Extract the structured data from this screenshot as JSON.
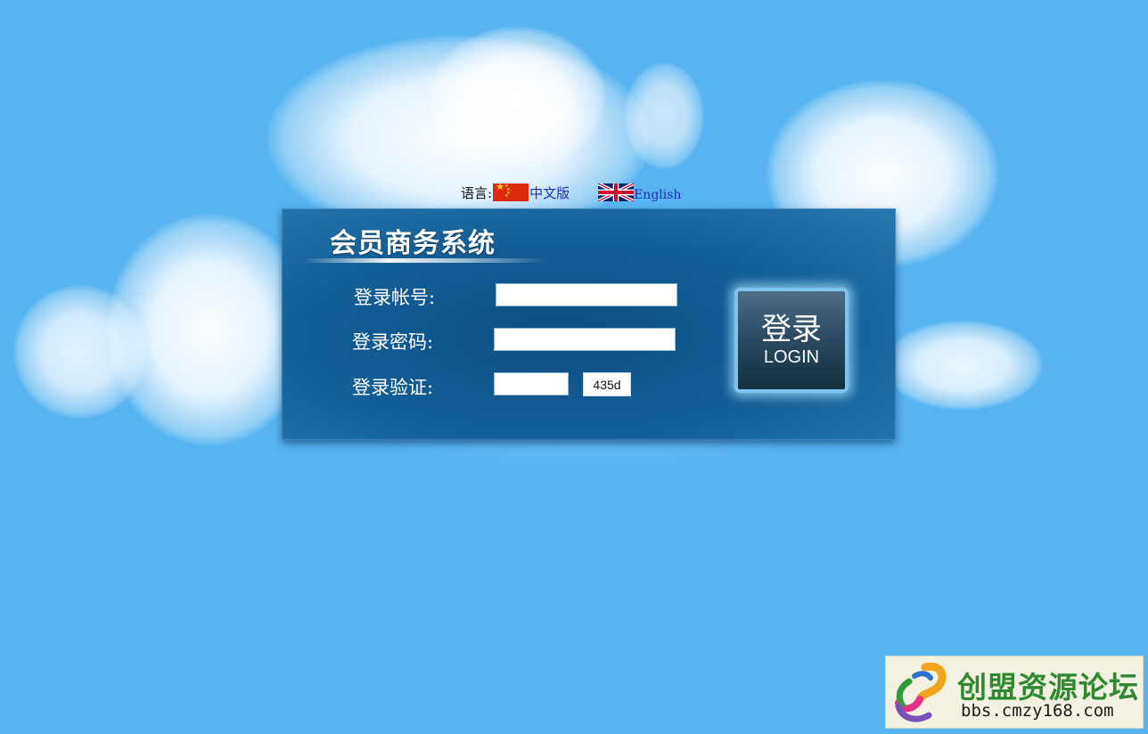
{
  "language_bar": {
    "label": "语言:",
    "chinese_link": "中文版",
    "english_link": "English",
    "icons": [
      "china-flag-icon",
      "uk-flag-icon"
    ]
  },
  "login_panel": {
    "title": "会员商务系统",
    "account_label": "登录帐号:",
    "account_value": "",
    "password_label": "登录密码:",
    "password_value": "",
    "captcha_label": "登录验证:",
    "captcha_input_value": "",
    "captcha_code": "435d",
    "login_button_zh": "登录",
    "login_button_en": "LOGIN"
  },
  "watermark": {
    "name": "创盟资源论坛",
    "url": "bbs.cmzy168.com"
  },
  "colors": {
    "background": "#57b4f1",
    "panel": "#0b4e83",
    "link": "#1b2fb8",
    "watermark_text": "#2e8a2e"
  }
}
